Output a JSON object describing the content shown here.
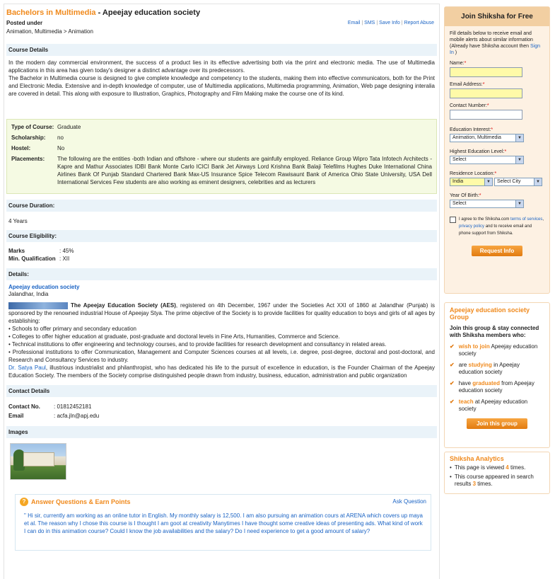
{
  "header": {
    "course_title": "Bachelors in Multimedia",
    "separator": " - ",
    "institute": "Apeejay education society",
    "posted_label": "Posted under",
    "posted_path": "Animation, Multimedia > Animation",
    "actions": [
      "Email",
      "SMS",
      "Save Info",
      "Report Abuse"
    ]
  },
  "course_details": {
    "heading": "Course Details",
    "para1": "In the modern day commercial environment, the success of a product lies in its effective advertising both via the print and electronic media. The use of Multimedia applications in this area has given today's designer a distinct advantage over its predecessors.",
    "para2": "The Bachelor in Multimedia course is designed to give complete knowledge and competency to the students, making them into effective communicators, both for the Print and Electronic Media. Extensive and in-depth knowledge of computer, use of Multimedia applications, Multimedia programming, Animation, Web page designing interalia are covered in detail. This along with exposure to Illustration, Graphics, Photography and Film Making make the course one of its kind."
  },
  "info_box": {
    "type_label": "Type of Course:",
    "type_value": "Graduate",
    "scholarship_label": "Scholarship:",
    "scholarship_value": "no",
    "hostel_label": "Hostel:",
    "hostel_value": "No",
    "placements_label": "Placements:",
    "placements_value": "The following are the entities -both Indian and offshore - where our students are gainfully employed. Reliance Group Wipro Tata Infotech Architects - Kapre and Mathur Associates IDBI Bank Monte Carlo ICICI Bank Jet Airways Lord Krishna Bank Balaji Telefilms Hughes Duke International China Airlines Bank Of Punjab Standard Chartered Bank Max-US Insurance Spice Telecom Rawisaunt Bank of America Ohio State University, USA Dell International Services Few students are also working as eminent designers, celebrities and as lecturers"
  },
  "duration": {
    "heading": "Course Duration:",
    "value": "4 Years"
  },
  "eligibility": {
    "heading": "Course Eligibility:",
    "marks_label": "Marks",
    "marks_value": ": 45%",
    "qual_label": "Min. Qualification",
    "qual_value": ": XII"
  },
  "details": {
    "heading": "Details:",
    "inst_name": "Apeejay education society",
    "inst_city": "Jalandhar, India",
    "about_bold": "The Apeejay Education Society (AES)",
    "about_text": ", registered on 4th December, 1967 under the Societies Act XXI of 1860 at Jalandhar (Punjab) is sponsored by the renowned industrial House of Apeejay Stya. The prime objective of the Society is to provide facilities for quality education to boys and girls of all ages by establishing:",
    "bullets": [
      "• Schools to offer primary and secondary education",
      "• Colleges to offer higher education at graduate, post-graduate and doctoral levels in Fine Arts, Humanities, Commerce and Science.",
      "• Technical institutions to offer engineering and technology courses, and to provide facilities for research development and consultancy in related areas.",
      "• Professional institutions to offer Communication, Management and Computer Sciences courses at all levels, i.e. degree, post-degree, doctoral and post-doctoral, and Research and Consultancy Services to industry."
    ],
    "founder_link": "Dr. Satya Paul",
    "founder_text": ", illustrious industrialist and philanthropist, who has dedicated his life to the pursuit of excellence in education, is the Founder Chairman of the Apeejay Education Society. The members of the Society comprise distinguished people drawn from industry, business, education, administration and public organization"
  },
  "contact": {
    "heading": "Contact Details",
    "no_label": "Contact No.",
    "no_value": ": 01812452181",
    "email_label": "Email",
    "email_value": ": acfa.jln@apj.edu"
  },
  "images": {
    "heading": "Images"
  },
  "qa": {
    "icon_text": "?",
    "title": "Answer Questions & Earn Points",
    "ask": "Ask Question",
    "question": "\" Hi sir, currently am working as an online tutor in English. My monthly salary is 12,500. I am also pursuing an animation cours at ARENA which covers up maya et al. The reason why I chose this course is I thought I am goot at creativity Manytimes I have thought some creative ideas of presenting ads. What kind of work I can do in this animation course? Could I know the job availabilities and the salary? Do I need experience to get a good amount of salary?"
  },
  "join": {
    "title": "Join Shiksha for Free",
    "desc": "Fill details below to receive email and mobile alerts about similar information (Already have Shiksha account then",
    "sign_in": "Sign In",
    "desc_end": ")",
    "name_label": "Name:",
    "email_label": "Email Address:",
    "contact_label": "Contact Number:",
    "edu_label": "Education Interest:",
    "edu_value": "Animation, Multimedia",
    "hel_label": "Highest Education Level:",
    "hel_value": "Select",
    "res_label": "Residence Location:",
    "country_value": "India",
    "city_value": "Select City",
    "yob_label": "Year Of Birth:",
    "yob_value": "Select",
    "required_mark": "*",
    "agree_pre": "I agree to the Shiksha.com",
    "terms_link": "terms of services",
    "agree_comma": ",",
    "privacy_link": "privacy policy",
    "agree_post": "and to receive email and phone support from Shiksha.",
    "button": "Request Info",
    "select_arrow": "▼"
  },
  "group": {
    "title": "Apeejay education society Group",
    "sub": "Join this group & stay connected with Shiksha members who:",
    "check": "✔",
    "items": [
      {
        "hl": "wish to join",
        "rest": " Apeejay education society",
        "pre": ""
      },
      {
        "hl": "studying",
        "rest": " in Apeejay education society",
        "pre": "are "
      },
      {
        "hl": "graduated",
        "rest": " from Apeejay education society",
        "pre": "have "
      },
      {
        "hl": "teach",
        "rest": " at Apeejay education society",
        "pre": ""
      }
    ],
    "button": "Join this group"
  },
  "analytics": {
    "title": "Shiksha Analytics",
    "bullet": "•",
    "viewed_pre": "This page is viewed ",
    "viewed_num": "4",
    "viewed_post": " times.",
    "searched_pre": "This course appeared in search results ",
    "searched_num": "3",
    "searched_post": " times."
  }
}
